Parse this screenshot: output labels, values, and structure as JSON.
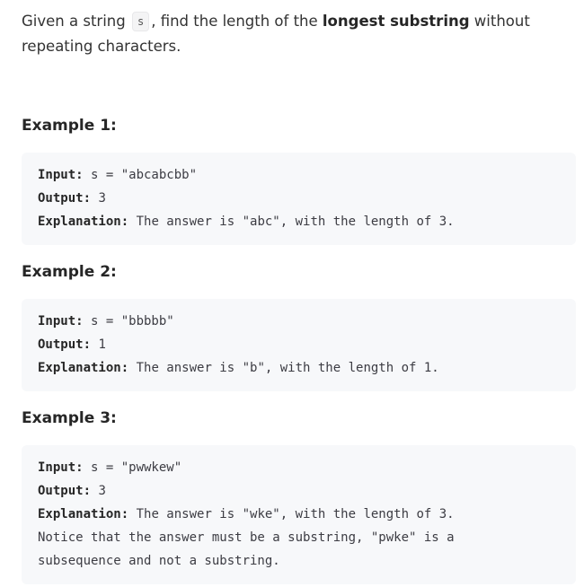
{
  "problem": {
    "desc_part1": "Given a string ",
    "var_name": "s",
    "desc_part2": ", find the length of the ",
    "desc_bold": "longest substring",
    "desc_part3": " without repeating characters."
  },
  "labels": {
    "input": "Input:",
    "output": "Output:",
    "explanation": "Explanation:"
  },
  "examples": [
    {
      "title": "Example 1:",
      "input": " s = \"abcabcbb\"",
      "output": " 3",
      "explanation": " The answer is \"abc\", with the length of 3."
    },
    {
      "title": "Example 2:",
      "input": " s = \"bbbbb\"",
      "output": " 1",
      "explanation": " The answer is \"b\", with the length of 1."
    },
    {
      "title": "Example 3:",
      "input": " s = \"pwwkew\"",
      "output": " 3",
      "explanation": " The answer is \"wke\", with the length of 3.",
      "note_line1": "Notice that the answer must be a substring, \"pwke\" is a",
      "note_line2": "subsequence and not a substring."
    }
  ]
}
